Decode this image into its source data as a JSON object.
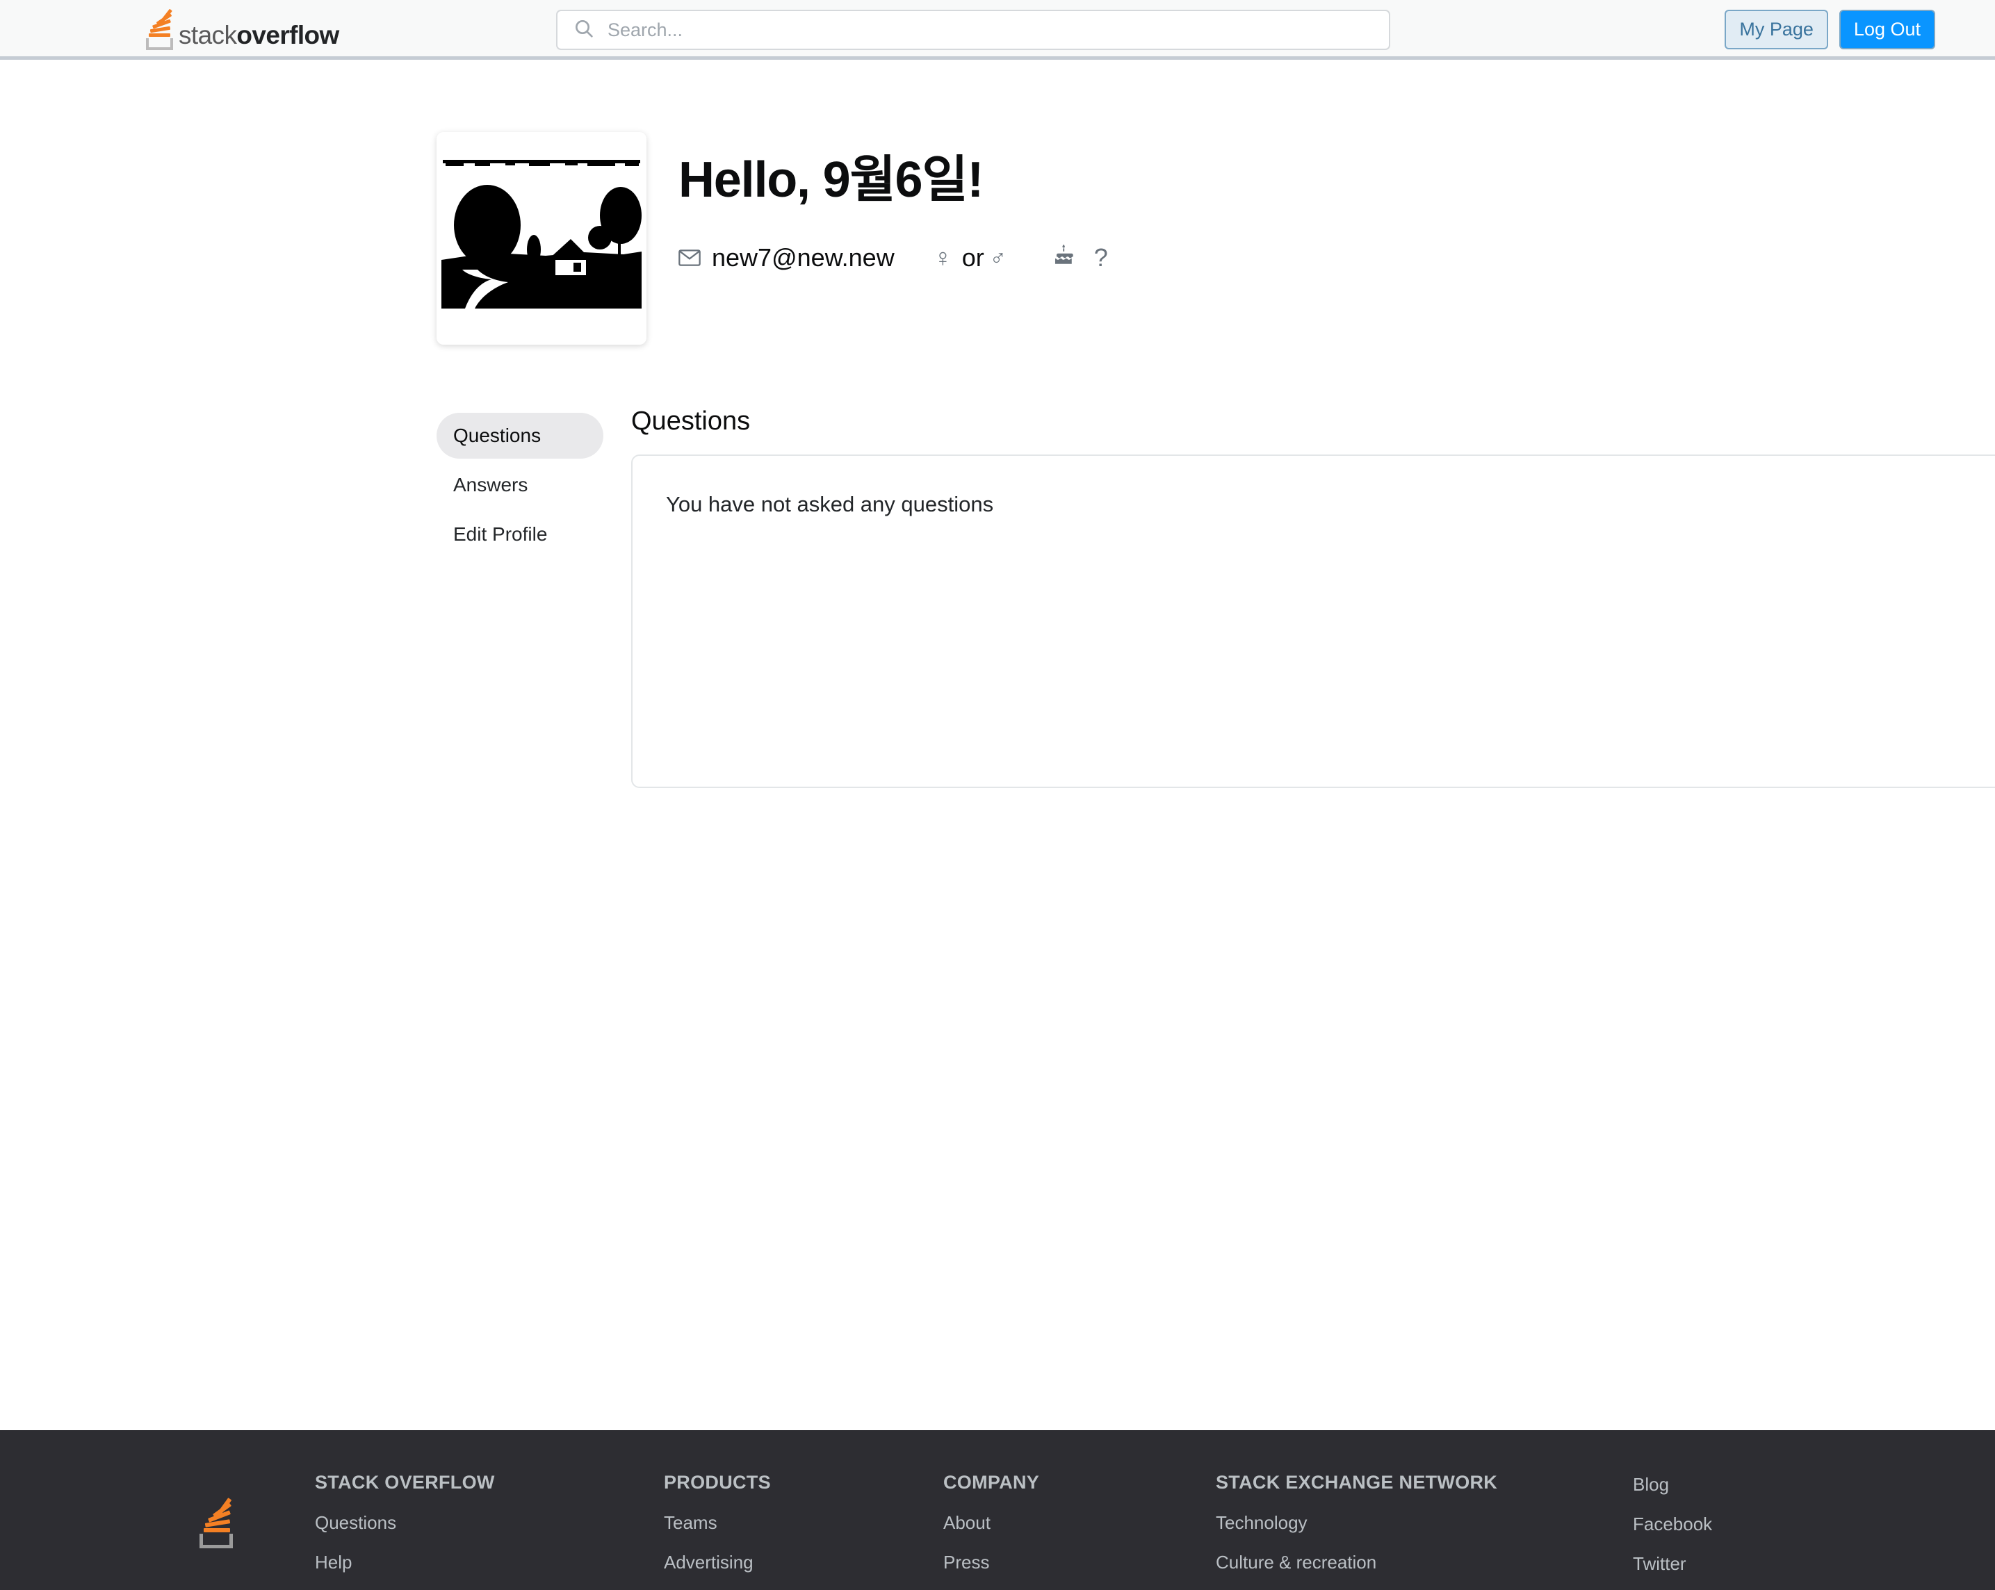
{
  "header": {
    "logo": {
      "light_text": "stack",
      "heavy_text": "overflow",
      "icon": "stack-overflow-logo-icon"
    },
    "search": {
      "placeholder": "Search...",
      "value": "",
      "icon": "search-icon"
    },
    "my_page_label": "My Page",
    "log_out_label": "Log Out"
  },
  "profile": {
    "avatar_alt": "user-avatar-landscape-silhouette",
    "greeting": "Hello, 9월6일!",
    "email": "new7@new.new",
    "email_icon": "envelope-icon",
    "gender": {
      "female_symbol": "♀",
      "or_label": "or",
      "male_symbol": "♂"
    },
    "birthday": {
      "cake_icon": "birthday-cake-icon",
      "value": "?"
    }
  },
  "sidebar": {
    "items": [
      {
        "label": "Questions",
        "active": true
      },
      {
        "label": "Answers",
        "active": false
      },
      {
        "label": "Edit Profile",
        "active": false
      }
    ]
  },
  "main": {
    "section_title": "Questions",
    "empty_message": "You have not asked any questions"
  },
  "footer": {
    "logo_icon": "stack-overflow-logo-icon",
    "columns": [
      {
        "heading": "STACK OVERFLOW",
        "links": [
          "Questions",
          "Help"
        ]
      },
      {
        "heading": "PRODUCTS",
        "links": [
          "Teams",
          "Advertising"
        ]
      },
      {
        "heading": "COMPANY",
        "links": [
          "About",
          "Press"
        ]
      },
      {
        "heading": "STACK EXCHANGE NETWORK",
        "links": [
          "Technology",
          "Culture & recreation"
        ]
      }
    ],
    "social": {
      "links": [
        "Blog",
        "Facebook",
        "Twitter"
      ]
    }
  },
  "colors": {
    "brand_orange": "#f48024",
    "primary_blue": "#0a95ff",
    "secondary_blue_bg": "#e1ecf4",
    "secondary_blue_text": "#39739d",
    "header_bg": "#f8f9f9",
    "header_border": "#c5ccd4",
    "footer_bg": "#2d2d32",
    "footer_text": "#babfc4",
    "active_pill": "#e9e9eb"
  }
}
